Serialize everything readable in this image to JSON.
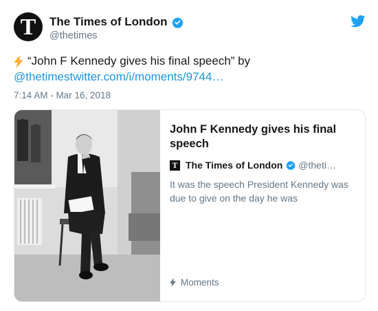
{
  "account": {
    "name": "The Times of London",
    "handle": "@thetimes",
    "avatar_letter": "T"
  },
  "tweet": {
    "text_line1": "“John F Kennedy gives his final speech” by",
    "link": "@thetimestwitter.com/i/moments/9744…",
    "timestamp": "7:14 AM - Mar 16, 2018"
  },
  "card": {
    "title": "John F Kennedy gives his final speech",
    "source_logo": "T",
    "source_name": "The Times of London",
    "source_handle": "@theti…",
    "description": "It was the speech President Kennedy was due to give on the day he was",
    "footer_label": "Moments"
  },
  "colors": {
    "link": "#1b95e0",
    "verified": "#1da1f2",
    "bolt": "#ffac33",
    "muted": "#657786",
    "text": "#14171a"
  },
  "icons": {
    "verified": "verified-badge-icon",
    "bird": "twitter-bird-icon",
    "bolt": "lightning-bolt-icon"
  }
}
